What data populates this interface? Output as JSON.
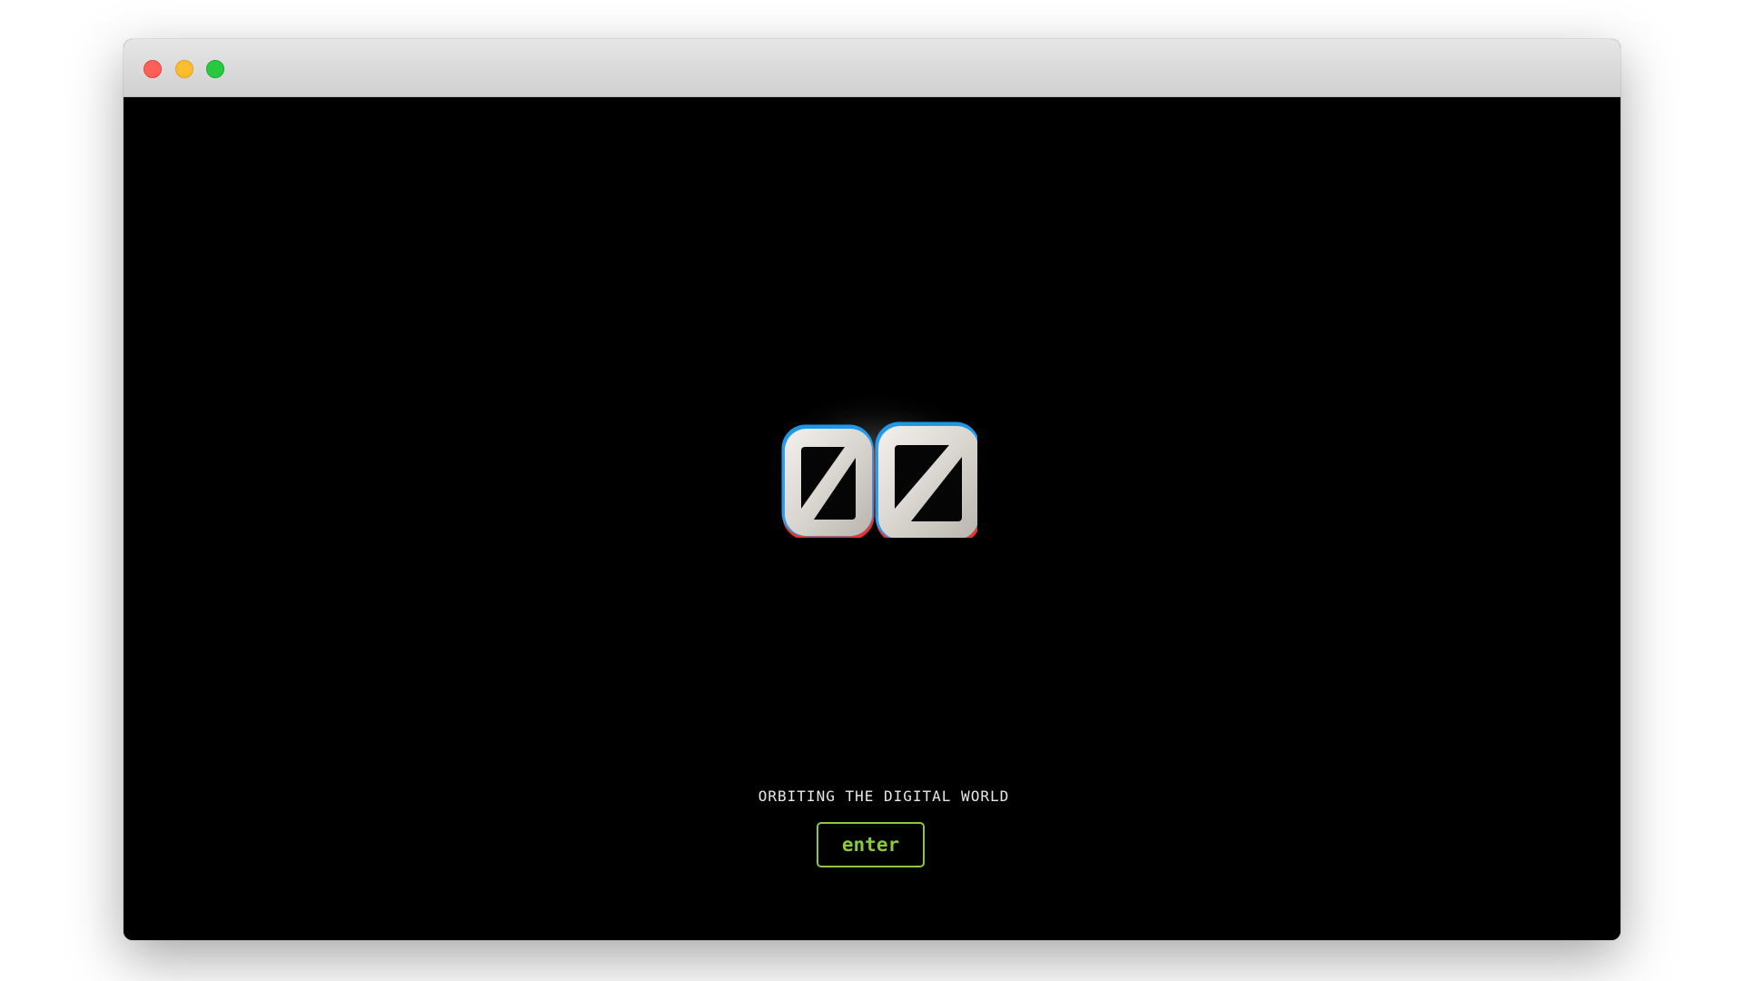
{
  "window": {
    "controls": [
      "close",
      "minimize",
      "maximize"
    ]
  },
  "logo": {
    "text": "00",
    "icon": "logo-glyph-icon"
  },
  "tagline": "ORBITING THE DIGITAL WORLD",
  "enter_button": {
    "label": "enter"
  },
  "colors": {
    "background": "#000000",
    "accent": "#8dc63f",
    "tagline": "#e8e8e8",
    "close": "#ff5f57",
    "minimize": "#febc2e",
    "maximize": "#28c840"
  }
}
